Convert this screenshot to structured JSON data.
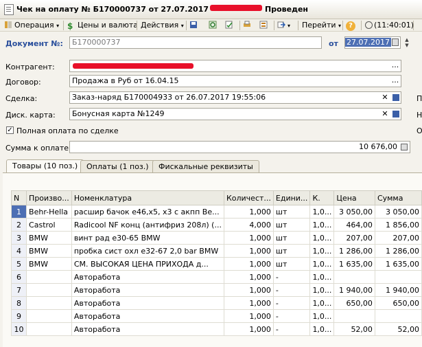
{
  "window": {
    "title_prefix": "Чек на оплату № Б170000737 от 27.07.2017",
    "title_suffix": "Проведен"
  },
  "toolbar": {
    "operation": "Операция",
    "prices": "Цены и валюта",
    "actions": "Действия",
    "goto": "Перейти",
    "help": "?",
    "time": "(11:40:01)"
  },
  "header": {
    "doc_label": "Документ №:",
    "doc_number": "Б170000737",
    "date_label": "от",
    "date_value": "27.07.2017"
  },
  "form": {
    "counterparty_label": "Контрагент:",
    "contract_label": "Договор:",
    "contract_value": "Продажа в Руб от 16.04.15",
    "deal_label": "Сделка:",
    "deal_value": "Заказ-наряд Б170004933 от 26.07.2017 19:55:06",
    "card_label": "Диск. карта:",
    "card_value": "Бонусная карта №1249",
    "full_payment_label": "Полная оплата по сделке",
    "sum_label": "Сумма к оплате:",
    "sum_value": "10 676,00",
    "side_p": "П",
    "side_n": "Н",
    "side_o": "О"
  },
  "tabs": [
    {
      "label": "Товары (10 поз.)"
    },
    {
      "label": "Оплаты (1 поз.)"
    },
    {
      "label": "Фискальные реквизиты"
    }
  ],
  "table": {
    "headers": [
      "N",
      "Произво...",
      "Номенклатура",
      "Количест...",
      "Едини...",
      "К.",
      "Цена",
      "Сумма"
    ],
    "rows": [
      [
        "1",
        "Behr-Hella",
        "расшир бачок е46,х5, х3 с акпп Be...",
        "1,000",
        "шт",
        "1,0...",
        "3 050,00",
        "3 050,00"
      ],
      [
        "2",
        "Castrol",
        "Radicool NF конц (антифриз 208л) (...",
        "4,000",
        "шт",
        "1,0...",
        "464,00",
        "1 856,00"
      ],
      [
        "3",
        "BMW",
        "винт рад е30-65 BMW",
        "1,000",
        "шт",
        "1,0...",
        "207,00",
        "207,00"
      ],
      [
        "4",
        "BMW",
        "пробка сист охл е32-67 2,0 bar BMW",
        "1,000",
        "шт",
        "1,0...",
        "1 286,00",
        "1 286,00"
      ],
      [
        "5",
        "BMW",
        "СМ. ВЫСОКАЯ ЦЕНА ПРИХОДА д...",
        "1,000",
        "шт",
        "1,0...",
        "1 635,00",
        "1 635,00"
      ],
      [
        "6",
        "",
        "Авторабота",
        "1,000",
        "-",
        "1,0...",
        "",
        ""
      ],
      [
        "7",
        "",
        "Авторабота",
        "1,000",
        "-",
        "1,0...",
        "1 940,00",
        "1 940,00"
      ],
      [
        "8",
        "",
        "Авторабота",
        "1,000",
        "-",
        "1,0...",
        "650,00",
        "650,00"
      ],
      [
        "9",
        "",
        "Авторабота",
        "1,000",
        "-",
        "1,0...",
        "",
        ""
      ],
      [
        "10",
        "",
        "Авторабота",
        "1,000",
        "-",
        "1,0...",
        "52,00",
        "52,00"
      ]
    ]
  },
  "colors": {
    "redaction": "#e8102a",
    "selected_row": "#4d6fb4",
    "label_blue": "#2a4f9c"
  }
}
